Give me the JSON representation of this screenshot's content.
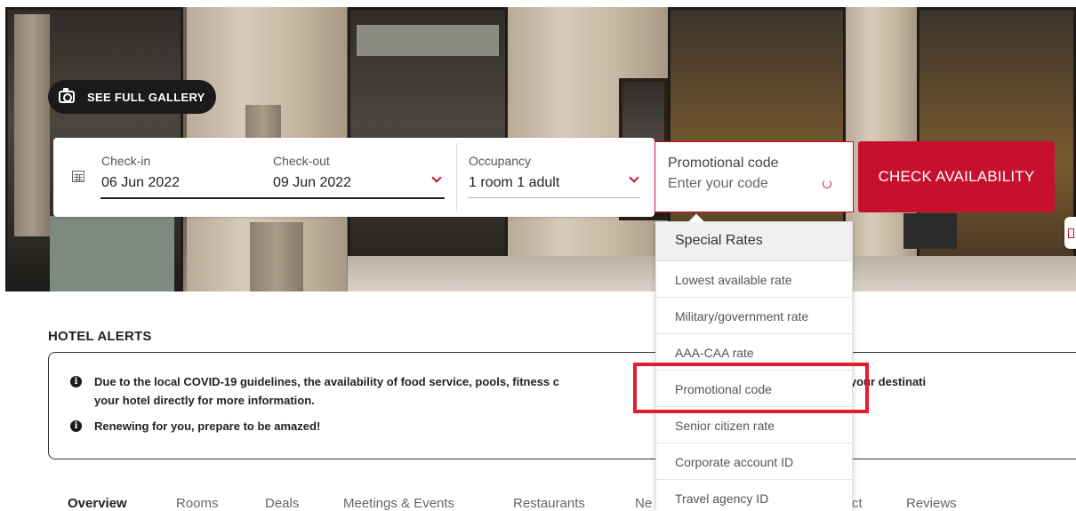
{
  "gallery": {
    "label": "SEE FULL GALLERY"
  },
  "booking": {
    "checkin_label": "Check-in",
    "checkin_value": "06 Jun 2022",
    "checkout_label": "Check-out",
    "checkout_value": "09 Jun 2022",
    "occupancy_label": "Occupancy",
    "occupancy_value": "1 room 1 adult",
    "promo_label": "Promotional code",
    "promo_placeholder": "Enter your code",
    "check_button": "CHECK AVAILABILITY"
  },
  "special_rates": {
    "heading": "Special Rates",
    "items": [
      "Lowest available rate",
      "Military/government rate",
      "AAA-CAA rate",
      "Promotional code",
      "Senior citizen rate",
      "Corporate account ID",
      "Travel agency ID"
    ],
    "highlighted": "Promotional code"
  },
  "alerts": {
    "heading": "HOTEL ALERTS",
    "line1a": "Due to the local COVID-19 guidelines, the availability of food service, pools, fitness c",
    "line1b": "ay be disrupted at your destinati",
    "line2": "your hotel directly for more information.",
    "line3": "Renewing for you, prepare to be amazed!"
  },
  "tabs": [
    "Overview",
    "Rooms",
    "Deals",
    "Meetings & Events",
    "Restaurants",
    "Ne",
    "ct",
    "Reviews"
  ],
  "colors": {
    "accent": "#c8102e",
    "highlight": "#e11d2a"
  }
}
